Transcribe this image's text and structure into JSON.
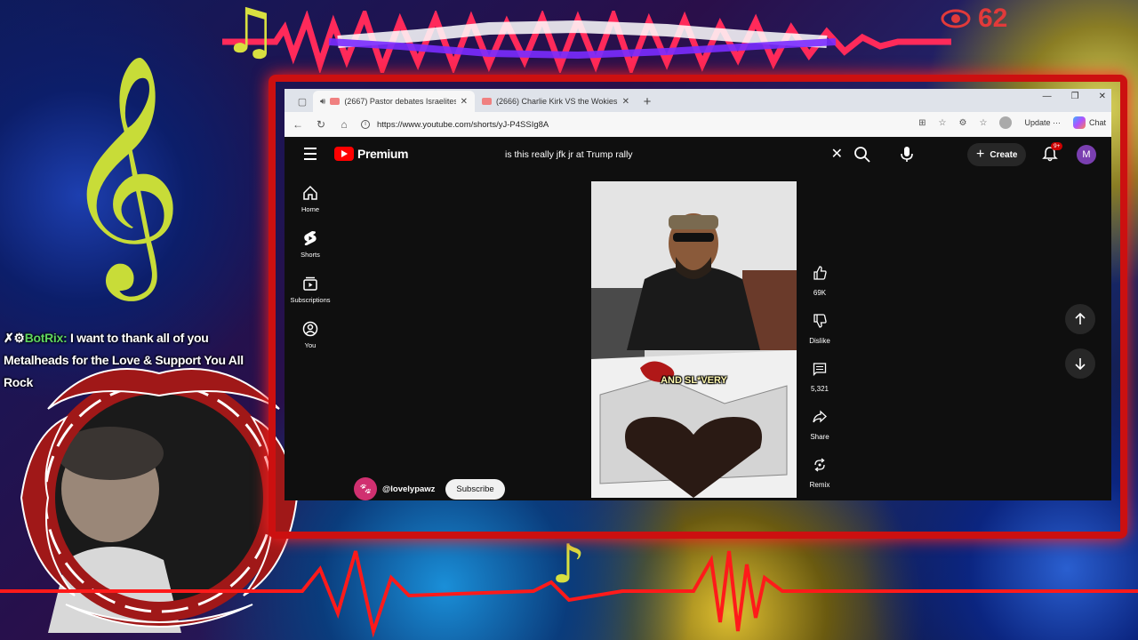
{
  "overlay": {
    "viewer_count": "62",
    "botrix_name": "BotRix:",
    "botrix_message": "I want to thank all of you Metalheads for the Love & Support You All Rock"
  },
  "browser": {
    "tabs": [
      {
        "title": "(2667) Pastor debates Israelites",
        "active": true,
        "audio": true
      },
      {
        "title": "(2666) Charlie Kirk VS the Wokies",
        "active": false,
        "audio": false
      }
    ],
    "url": "https://www.youtube.com/shorts/yJ-P4SSIg8A",
    "update_label": "Update",
    "chat_label": "Chat"
  },
  "youtube": {
    "brand": "Premium",
    "search_query": "is this really jfk jr at Trump rally",
    "create_label": "Create",
    "notification_badge": "9+",
    "user_initial": "M",
    "sidenav": [
      {
        "label": "Home",
        "icon": "home-icon"
      },
      {
        "label": "Shorts",
        "icon": "shorts-icon"
      },
      {
        "label": "Subscriptions",
        "icon": "subscriptions-icon"
      },
      {
        "label": "You",
        "icon": "you-icon"
      }
    ],
    "video_caption": "AND SL*VERY",
    "channel_handle": "@lovelypawz",
    "subscribe_label": "Subscribe",
    "actions": [
      {
        "label": "69K",
        "icon": "like-icon"
      },
      {
        "label": "Dislike",
        "icon": "dislike-icon"
      },
      {
        "label": "5,321",
        "icon": "comment-icon"
      },
      {
        "label": "Share",
        "icon": "share-icon"
      },
      {
        "label": "Remix",
        "icon": "remix-icon"
      }
    ]
  },
  "colors": {
    "frame_red": "#cc1010",
    "youtube_red": "#ff0000",
    "yt_bg": "#0f0f0f"
  }
}
